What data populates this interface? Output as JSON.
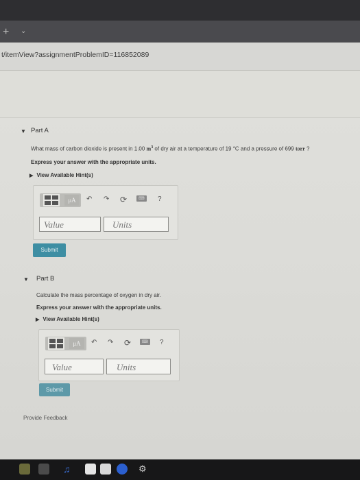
{
  "browser": {
    "tab_new_icon": "plus-icon",
    "tab_menu_icon": "chevron-down-icon",
    "url": "t/itemView?assignmentProblemID=116852089"
  },
  "part_a": {
    "title": "Part A",
    "question_before": "What mass of carbon dioxide is present in 1.00 ",
    "volume_unit": "m",
    "volume_exp": "3",
    "question_middle": " of dry air at a temperature of 19 ",
    "temp_unit": "°C",
    "question_after": " and a pressure of 699 ",
    "pressure_unit": "torr",
    "question_end": " ?",
    "instruction": "Express your answer with the appropriate units.",
    "hint": "View Available Hint(s)",
    "value_placeholder": "Value",
    "units_placeholder": "Units",
    "submit": "Submit"
  },
  "part_b": {
    "title": "Part B",
    "question": "Calculate the mass percentage of oxygen in dry air.",
    "instruction": "Express your answer with the appropriate units.",
    "hint": "View Available Hint(s)",
    "value_placeholder": "Value",
    "units_placeholder": "Units",
    "submit": "Submit"
  },
  "toolbar": {
    "mu_label": "μA",
    "help_label": "?",
    "icons": [
      "templates-icon",
      "units-mu-icon",
      "undo-icon",
      "redo-icon",
      "reset-icon",
      "keyboard-icon",
      "help-icon"
    ]
  },
  "footer": {
    "feedback": "Provide Feedback"
  },
  "colors": {
    "submit_bg": "#3e8ea3",
    "page_bg": "#dcdcd8"
  }
}
